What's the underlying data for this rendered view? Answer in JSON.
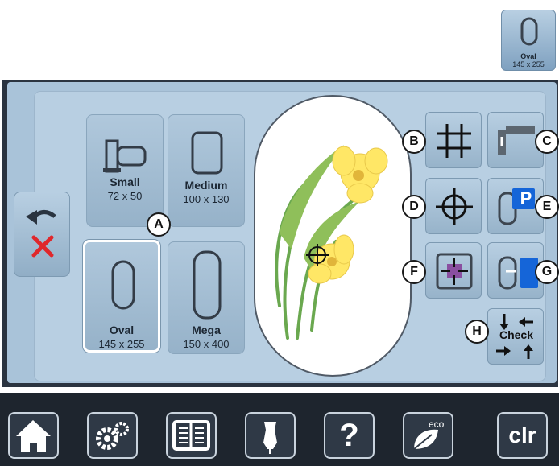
{
  "preview": {
    "name": "Oval",
    "size": "145 x 255"
  },
  "hoops": [
    {
      "name": "Small",
      "size": "72 x 50"
    },
    {
      "name": "Medium",
      "size": "100 x 130"
    },
    {
      "name": "Oval",
      "size": "145 x 255"
    },
    {
      "name": "Mega",
      "size": "150 x 400"
    }
  ],
  "callouts": {
    "a": "A",
    "b": "B",
    "c": "C",
    "d": "D",
    "e": "E",
    "f": "F",
    "g": "G",
    "h": "H"
  },
  "check_label": "Check",
  "parking_label": "P",
  "bottom_bar": {
    "help": "?",
    "eco": "eco",
    "clr": "clr"
  },
  "colors": {
    "accent_blue": "#1565d8",
    "cancel_red": "#e0272b",
    "panel": "#b8cfe2",
    "bar": "#1e252e"
  },
  "icons": [
    "home-icon",
    "settings-icon",
    "tutorial-icon",
    "dress-form-icon",
    "help-icon",
    "eco-icon",
    "clear-icon",
    "undo-icon",
    "cancel-icon",
    "grid-icon",
    "crosshair-icon",
    "park-icon",
    "check-icon"
  ]
}
